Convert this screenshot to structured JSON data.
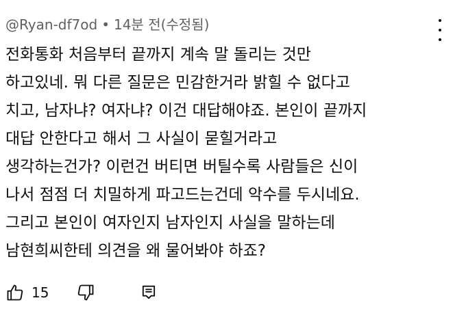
{
  "comment": {
    "author": "@Ryan-df7od",
    "separator": "•",
    "time": "14분 전(수정됨)",
    "lines": [
      "전화통화 처음부터 끝까지 계속 말 돌리는 것만",
      "하고있네. 뭐 다른 질문은 민감한거라 밝힐 수 없다고",
      "치고, 남자냐? 여자냐? 이건 대답해야죠. 본인이 끝까지",
      "대답 안한다고 해서 그 사실이 묻힐거라고",
      "생각하는건가? 이런건 버티면 버틸수록 사람들은 신이",
      "나서 점점 더 치밀하게 파고드는건데 악수를 두시네요.",
      "그리고 본인이 여자인지 남자인지 사실을 말하는데",
      "남현희씨한테 의견을 왜 물어봐야 하죠?"
    ],
    "like_count": "15"
  },
  "icons": {
    "more": "more-vertical-icon",
    "like": "thumbs-up-icon",
    "dislike": "thumbs-down-icon",
    "reply": "reply-comment-icon"
  }
}
